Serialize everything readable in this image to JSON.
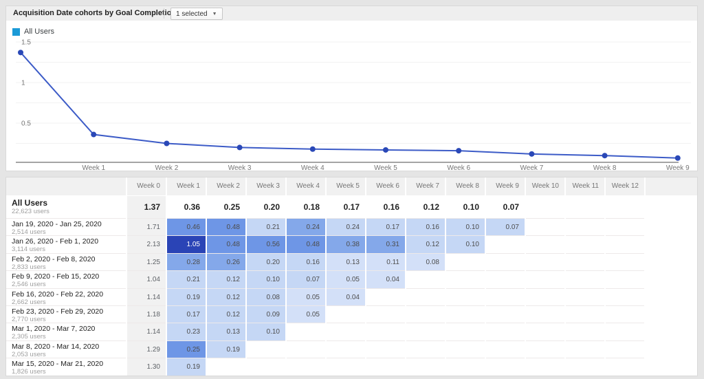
{
  "card_header": {
    "title": "Acquisition Date cohorts by Goal Completions per User",
    "selector_label": "1 selected",
    "caret_icon": "▼"
  },
  "legend": {
    "label": "All Users",
    "color": "#1b9ad7"
  },
  "chart_data": {
    "type": "line",
    "title": "Acquisition Date cohorts by Goal Completions per User",
    "x_labels": [
      "",
      "Week 1",
      "Week 2",
      "Week 3",
      "Week 4",
      "Week 5",
      "Week 6",
      "Week 7",
      "Week 8",
      "Week 9"
    ],
    "series": [
      {
        "name": "All Users",
        "values": [
          1.37,
          0.36,
          0.25,
          0.2,
          0.18,
          0.17,
          0.16,
          0.12,
          0.1,
          0.07
        ]
      }
    ],
    "ylim": [
      0,
      1.5
    ],
    "y_ticks": [
      0.5,
      1,
      1.5
    ],
    "y_tick_labels": [
      "0.5",
      "1",
      "1.5"
    ],
    "grid": true,
    "legend_position": "top-left",
    "line_color": "#3c5bc7",
    "point_color": "#2a48b7",
    "axis_color": "#6e6e6e",
    "grid_color": "#f2f2f2",
    "tick_text_color": "#757575"
  },
  "table": {
    "week_headers": [
      "Week 0",
      "Week 1",
      "Week 2",
      "Week 3",
      "Week 4",
      "Week 5",
      "Week 6",
      "Week 7",
      "Week 8",
      "Week 9",
      "Week 10",
      "Week 11",
      "Week 12"
    ],
    "summary": {
      "label": "All Users",
      "sublabel": "22,623 users",
      "values": [
        "1.37",
        "0.36",
        "0.25",
        "0.20",
        "0.18",
        "0.17",
        "0.16",
        "0.12",
        "0.10",
        "0.07",
        "",
        "",
        ""
      ]
    },
    "rows": [
      {
        "label": "Jan 19, 2020 - Jan 25, 2020",
        "sublabel": "2,514 users",
        "values": [
          "1.71",
          "0.46",
          "0.48",
          "0.21",
          "0.24",
          "0.24",
          "0.17",
          "0.16",
          "0.10",
          "0.07",
          "",
          "",
          ""
        ],
        "levels": [
          "g",
          "m",
          "m",
          "l",
          "ml",
          "l",
          "l",
          "l",
          "l",
          "l",
          "",
          "",
          ""
        ]
      },
      {
        "label": "Jan 26, 2020 - Feb 1, 2020",
        "sublabel": "3,114 users",
        "values": [
          "2.13",
          "1.05",
          "0.48",
          "0.56",
          "0.48",
          "0.38",
          "0.31",
          "0.12",
          "0.10",
          "",
          "",
          "",
          ""
        ],
        "levels": [
          "g",
          "d",
          "m",
          "m",
          "m",
          "ml",
          "ml",
          "l",
          "l",
          "",
          "",
          "",
          ""
        ]
      },
      {
        "label": "Feb 2, 2020 - Feb 8, 2020",
        "sublabel": "2,833 users",
        "values": [
          "1.25",
          "0.28",
          "0.26",
          "0.20",
          "0.16",
          "0.13",
          "0.11",
          "0.08",
          "",
          "",
          "",
          "",
          ""
        ],
        "levels": [
          "g",
          "ml",
          "ml",
          "l",
          "l",
          "xl",
          "xl",
          "xl",
          "",
          "",
          "",
          "",
          ""
        ]
      },
      {
        "label": "Feb 9, 2020 - Feb 15, 2020",
        "sublabel": "2,546 users",
        "values": [
          "1.04",
          "0.21",
          "0.12",
          "0.10",
          "0.07",
          "0.05",
          "0.04",
          "",
          "",
          "",
          "",
          "",
          ""
        ],
        "levels": [
          "g",
          "l",
          "l",
          "l",
          "l",
          "xl",
          "xl",
          "",
          "",
          "",
          "",
          "",
          ""
        ]
      },
      {
        "label": "Feb 16, 2020 - Feb 22, 2020",
        "sublabel": "2,662 users",
        "values": [
          "1.14",
          "0.19",
          "0.12",
          "0.08",
          "0.05",
          "0.04",
          "",
          "",
          "",
          "",
          "",
          "",
          ""
        ],
        "levels": [
          "g",
          "l",
          "l",
          "l",
          "xl",
          "xl",
          "",
          "",
          "",
          "",
          "",
          "",
          ""
        ]
      },
      {
        "label": "Feb 23, 2020 - Feb 29, 2020",
        "sublabel": "2,770 users",
        "values": [
          "1.18",
          "0.17",
          "0.12",
          "0.09",
          "0.05",
          "",
          "",
          "",
          "",
          "",
          "",
          "",
          ""
        ],
        "levels": [
          "g",
          "l",
          "l",
          "l",
          "xl",
          "",
          "",
          "",
          "",
          "",
          "",
          "",
          ""
        ]
      },
      {
        "label": "Mar 1, 2020 - Mar 7, 2020",
        "sublabel": "2,305 users",
        "values": [
          "1.14",
          "0.23",
          "0.13",
          "0.10",
          "",
          "",
          "",
          "",
          "",
          "",
          "",
          "",
          ""
        ],
        "levels": [
          "g",
          "l",
          "l",
          "l",
          "",
          "",
          "",
          "",
          "",
          "",
          "",
          "",
          ""
        ]
      },
      {
        "label": "Mar 8, 2020 - Mar 14, 2020",
        "sublabel": "2,053 users",
        "values": [
          "1.29",
          "0.25",
          "0.19",
          "",
          "",
          "",
          "",
          "",
          "",
          "",
          "",
          "",
          ""
        ],
        "levels": [
          "g",
          "m",
          "l",
          "",
          "",
          "",
          "",
          "",
          "",
          "",
          "",
          "",
          ""
        ]
      },
      {
        "label": "Mar 15, 2020 - Mar 21, 2020",
        "sublabel": "1,826 users",
        "values": [
          "1.30",
          "0.19",
          "",
          "",
          "",
          "",
          "",
          "",
          "",
          "",
          "",
          "",
          ""
        ],
        "levels": [
          "g",
          "l",
          "",
          "",
          "",
          "",
          "",
          "",
          "",
          "",
          "",
          "",
          ""
        ]
      }
    ],
    "heat_palette": {
      "d": "#2a44b6",
      "m": "#6e96e6",
      "ml": "#84a8ea",
      "l": "#c5d7f5",
      "xl": "#d3e0f8",
      "g": "#f1f1f1"
    },
    "dark_cell_text": "#ffffff",
    "week0_text": "#5f6368"
  }
}
